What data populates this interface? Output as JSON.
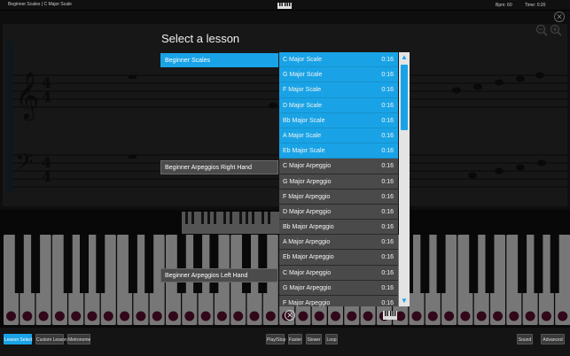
{
  "topbar": {
    "lesson_path": "Beginner Scales  |  C Major Scale",
    "bpm": "Bpm: 60",
    "time": "Time: 0:20"
  },
  "dialog": {
    "title": "Select a lesson",
    "categories": [
      {
        "label": "Beginner Scales",
        "active": true
      },
      {
        "label": "Beginner Arpeggios Right Hand",
        "active": false
      },
      {
        "label": "Beginner Arpeggios Left Hand",
        "active": false
      }
    ],
    "lessons": [
      {
        "name": "C Major Scale",
        "duration": "0:16",
        "selected": true
      },
      {
        "name": "G Major Scale",
        "duration": "0:16",
        "selected": true
      },
      {
        "name": "F Major Scale",
        "duration": "0:16",
        "selected": true
      },
      {
        "name": "D Major Scale",
        "duration": "0:16",
        "selected": true
      },
      {
        "name": "Bb Major Scale",
        "duration": "0:16",
        "selected": true
      },
      {
        "name": "A Major Scale",
        "duration": "0:16",
        "selected": true
      },
      {
        "name": "Eb Major Scale",
        "duration": "0:16",
        "selected": true
      },
      {
        "name": "C Major Arpeggio",
        "duration": "0:16",
        "selected": false
      },
      {
        "name": "G Major Arpeggio",
        "duration": "0:16",
        "selected": false
      },
      {
        "name": "F Major Arpeggio",
        "duration": "0:16",
        "selected": false
      },
      {
        "name": "D Major Arpeggio",
        "duration": "0:16",
        "selected": false
      },
      {
        "name": "Bb Major Arpeggio",
        "duration": "0:16",
        "selected": false
      },
      {
        "name": "A Major Arpeggio",
        "duration": "0:16",
        "selected": false
      },
      {
        "name": "Eb Major Arpeggio",
        "duration": "0:16",
        "selected": false
      },
      {
        "name": "C Major Arpeggio",
        "duration": "0:16",
        "selected": false
      },
      {
        "name": "G Major Arpeggio",
        "duration": "0:16",
        "selected": false
      },
      {
        "name": "F Major Arpeggio",
        "duration": "0:16",
        "selected": false
      }
    ]
  },
  "toolbar": {
    "select_lesson": "Lesson Select",
    "custom_lesson": "Custom Lesson",
    "metronome": "Metronome",
    "play_stop": "Play/Stop",
    "faster": "Faster",
    "slower": "Slower",
    "loop": "Loop",
    "sound": "Sound",
    "advanced": "Advanced"
  },
  "colors": {
    "accent": "#19a3e6",
    "row_bg": "#4a4a4a",
    "key_dot": "#5a1030"
  },
  "icons": [
    "piano-icon",
    "close-icon",
    "zoom-out-icon",
    "zoom-in-icon",
    "scroll-up-icon",
    "scroll-down-icon",
    "treble-clef-icon",
    "bass-clef-icon"
  ]
}
